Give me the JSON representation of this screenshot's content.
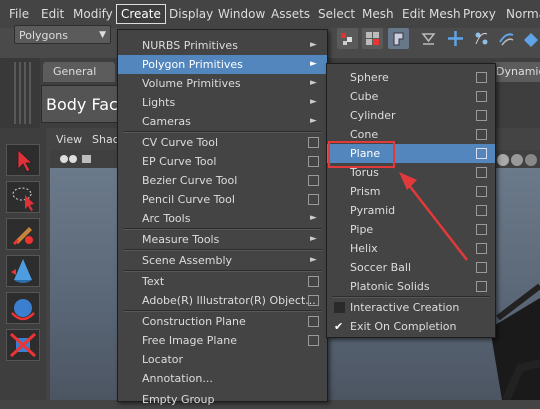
{
  "menubar": {
    "items": [
      "File",
      "Edit",
      "Modify",
      "Create",
      "Display",
      "Window",
      "Assets",
      "Select",
      "Mesh",
      "Edit Mesh",
      "Proxy",
      "Normal"
    ],
    "active": "Create"
  },
  "toolbar": {
    "mode_select": "Polygons"
  },
  "shelf": {
    "tab_general": "General",
    "tab_dynamics": "Dynamics",
    "field_value": "Body Face"
  },
  "viewport": {
    "menu_view": "View",
    "menu_shading": "Shad"
  },
  "create_menu": {
    "items": [
      "NURBS Primitives",
      "Polygon Primitives",
      "Volume Primitives",
      "Lights",
      "Cameras",
      "CV Curve Tool",
      "EP Curve Tool",
      "Bezier Curve Tool",
      "Pencil Curve Tool",
      "Arc Tools",
      "Measure Tools",
      "Scene Assembly",
      "Text",
      "Adobe(R) Illustrator(R) Object...",
      "Construction Plane",
      "Free Image Plane",
      "Locator",
      "Annotation...",
      "Empty Group"
    ],
    "highlighted": "Polygon Primitives"
  },
  "polygon_menu": {
    "items": [
      "Sphere",
      "Cube",
      "Cylinder",
      "Cone",
      "Plane",
      "Torus",
      "Prism",
      "Pyramid",
      "Pipe",
      "Helix",
      "Soccer Ball",
      "Platonic Solids"
    ],
    "highlighted": "Plane",
    "interactive_creation": "Interactive Creation",
    "exit_on_completion": "Exit On Completion",
    "interactive_creation_checked": false,
    "exit_on_completion_checked": true
  },
  "colors": {
    "highlight": "#5286bd",
    "annotation": "#e23a3a"
  }
}
